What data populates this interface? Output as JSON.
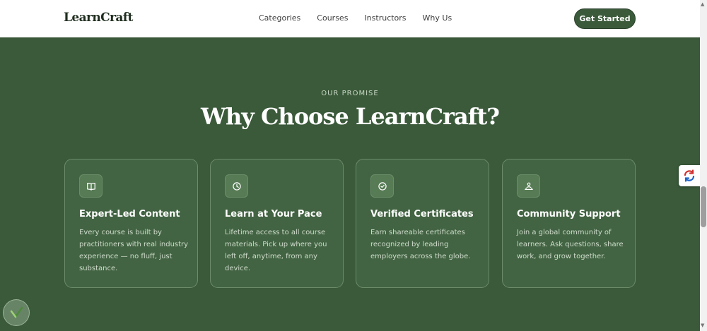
{
  "navbar": {
    "logo": "LearnCraft",
    "links": [
      "Categories",
      "Courses",
      "Instructors",
      "Why Us"
    ],
    "cta_label": "Get Started"
  },
  "section": {
    "eyebrow": "OUR PROMISE",
    "heading": "Why Choose LearnCraft?"
  },
  "features": [
    {
      "icon": "book-icon",
      "title": "Expert-Led Content",
      "description": "Every course is built by practitioners with real industry experience — no fluff, just substance."
    },
    {
      "icon": "clock-icon",
      "title": "Learn at Your Pace",
      "description": "Lifetime access to all course materials. Pick up where you left off, anytime, from any device."
    },
    {
      "icon": "check-badge-icon",
      "title": "Verified Certificates",
      "description": "Earn shareable certificates recognized by leading employers across the globe."
    },
    {
      "icon": "community-icon",
      "title": "Community Support",
      "description": "Join a global community of learners. Ask questions, share work, and grow together."
    }
  ],
  "colors": {
    "section_background": "#3a5a3a",
    "card_background": "#426442",
    "button_background": "#3a5a3a",
    "heading_text": "#ffffff"
  }
}
